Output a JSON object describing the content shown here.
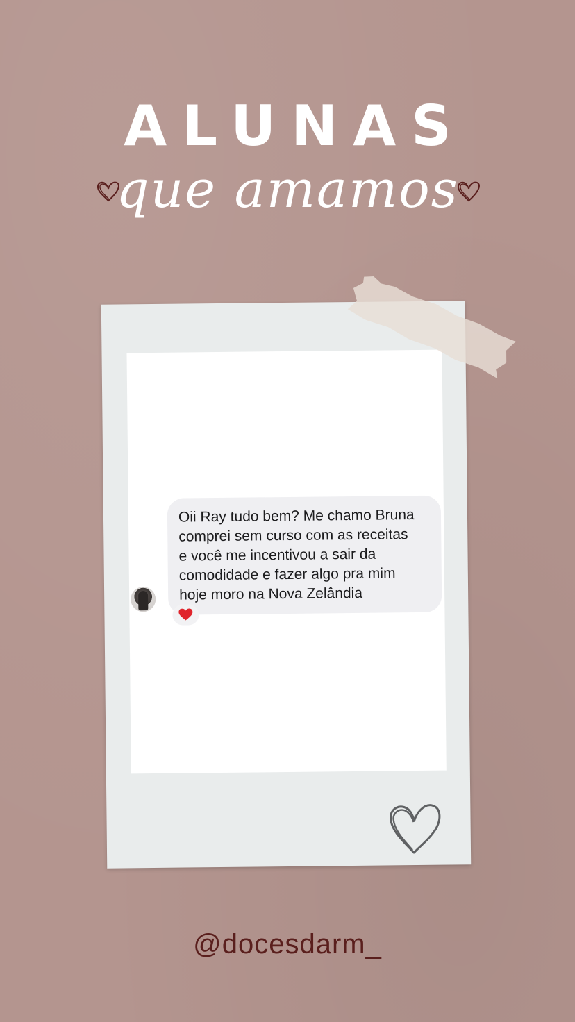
{
  "header": {
    "title": "ALUNAS",
    "subtitle": "que amamos"
  },
  "message": {
    "text_lines": [
      "Oii Ray tudo bem? Me chamo Bruna",
      "comprei sem curso com as receitas",
      "e você me incentivou a sair da",
      "comodidade e fazer algo pra mim",
      "hoje moro na Nova Zelândia"
    ],
    "reaction_icon": "red-heart-icon"
  },
  "footer": {
    "handle": "@docesdarm_"
  },
  "colors": {
    "background": "#b4958f",
    "heading": "#ffffff",
    "handle": "#5a1f1d",
    "heart_outline": "#5a1f1d",
    "reaction": "#e0242c"
  }
}
